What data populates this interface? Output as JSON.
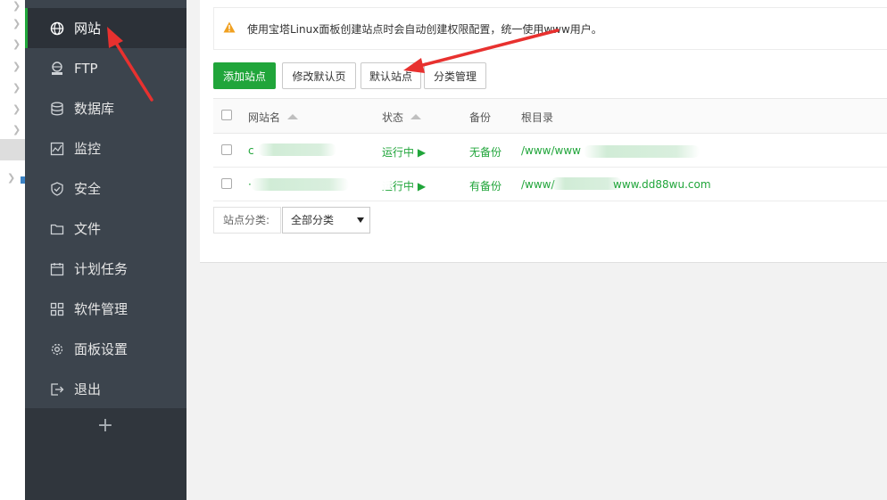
{
  "sidebar": {
    "items": [
      {
        "label": "网站",
        "icon": "globe-icon",
        "active": true
      },
      {
        "label": "FTP",
        "icon": "ftp-icon",
        "active": false
      },
      {
        "label": "数据库",
        "icon": "database-icon",
        "active": false
      },
      {
        "label": "监控",
        "icon": "monitor-icon",
        "active": false
      },
      {
        "label": "安全",
        "icon": "shield-icon",
        "active": false
      },
      {
        "label": "文件",
        "icon": "folder-icon",
        "active": false
      },
      {
        "label": "计划任务",
        "icon": "calendar-icon",
        "active": false
      },
      {
        "label": "软件管理",
        "icon": "grid-icon",
        "active": false
      },
      {
        "label": "面板设置",
        "icon": "gear-icon",
        "active": false
      },
      {
        "label": "退出",
        "icon": "logout-icon",
        "active": false
      }
    ],
    "add_label": "+"
  },
  "notice": {
    "text": "使用宝塔Linux面板创建站点时会自动创建权限配置，统一使用www用户。",
    "icon": "warning-icon"
  },
  "toolbar": {
    "add_site": "添加站点",
    "edit_default_page": "修改默认页",
    "default_site": "默认站点",
    "category_manage": "分类管理"
  },
  "table": {
    "headers": {
      "name": "网站名",
      "status": "状态",
      "backup": "备份",
      "root": "根目录"
    },
    "rows": [
      {
        "name": "c",
        "status": "运行中 ▶",
        "backup": "无备份",
        "root": "/www/www"
      },
      {
        "name": "·",
        "status": "运行中 ▶",
        "backup": "有备份",
        "root_prefix": "/www/",
        "root_suffix": "www.dd88wu.com"
      }
    ]
  },
  "filter": {
    "label": "站点分类:",
    "selected": "全部分类"
  },
  "colors": {
    "accent": "#20a53a",
    "sidebar": "#3c444d",
    "annotation": "#e8312f"
  }
}
